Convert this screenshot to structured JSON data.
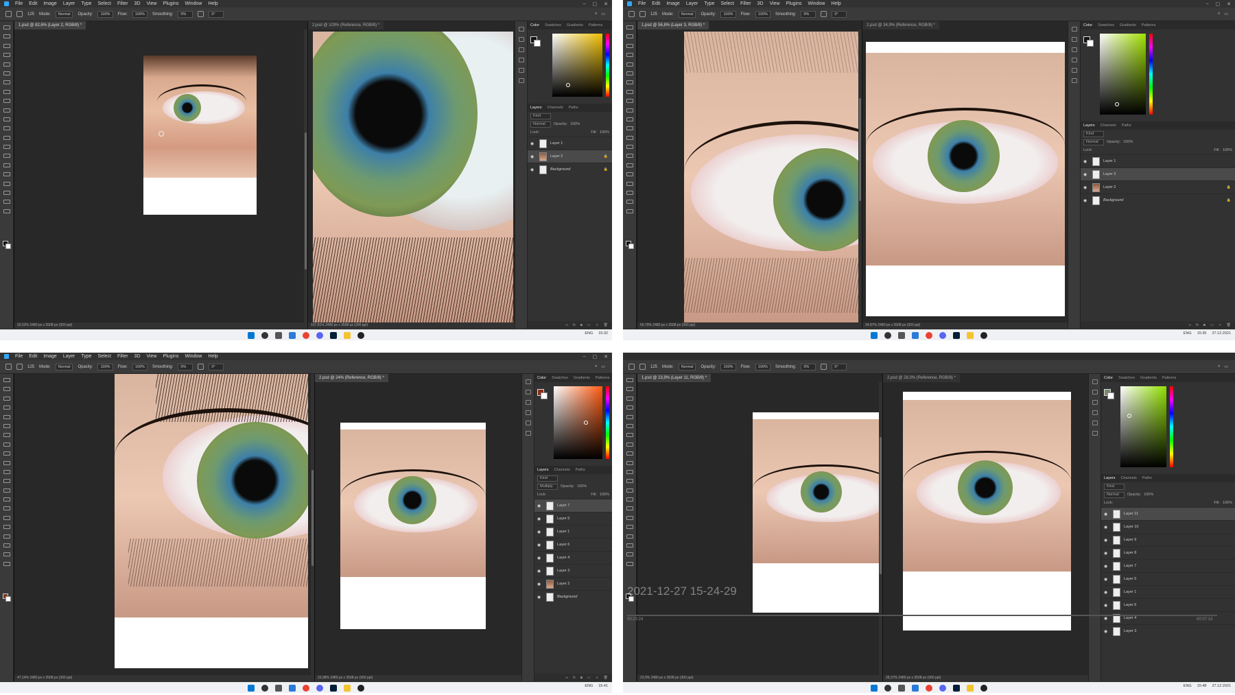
{
  "menu": [
    "File",
    "Edit",
    "Image",
    "Layer",
    "Type",
    "Select",
    "Filter",
    "3D",
    "View",
    "Plugins",
    "Window",
    "Help"
  ],
  "options": {
    "mode_label": "Mode:",
    "mode": "Normal",
    "opacity_label": "Opacity:",
    "opacity": "100%",
    "flow_label": "Flow:",
    "flow": "100%",
    "smoothing_label": "Smoothing:",
    "smoothing": "0%",
    "angle": "0°",
    "brush_size": "125"
  },
  "panel_tabs": [
    "Color",
    "Swatches",
    "Gradients",
    "Patterns"
  ],
  "layer_tabs": [
    "Layers",
    "Channels",
    "Paths"
  ],
  "layer_filter": "Kind",
  "fill_label": "Fill:",
  "lock_label": "Lock:",
  "taskbar": {
    "lang": "ENG"
  },
  "q0": {
    "tab1": "1.psd @ 82,6% (Layer 2, RGB/8) *",
    "tab2": "2.psd @ 103% (Reference, RGB/8) *",
    "status1": "15,53%   2480 px x 3508 px (300 ppi)",
    "status2": "107,81%   2480 px x 3508 px (300 ppi)",
    "blend": "Normal",
    "opacity": "100%",
    "fill": "100%",
    "layers": [
      {
        "name": "Layer 1",
        "italic": false,
        "sel": false,
        "pic": false,
        "lock": false
      },
      {
        "name": "Layer 2",
        "italic": false,
        "sel": true,
        "pic": true,
        "lock": true
      },
      {
        "name": "Background",
        "italic": true,
        "sel": false,
        "pic": false,
        "lock": true
      }
    ],
    "clock": "15:32"
  },
  "q1": {
    "tab1": "1.psd @ 56,8% (Layer 3, RGB/8) *",
    "tab2": "2.psd @ 34,9% (Reference, RGB/8) *",
    "status1": "56,79%   2480 px x 3508 px (300 ppi)",
    "status2": "34,87%   2480 px x 3508 px (300 ppi)",
    "blend": "Normal",
    "opacity": "100%",
    "fill": "100%",
    "layers": [
      {
        "name": "Layer 1",
        "italic": false,
        "sel": false,
        "pic": false,
        "lock": false
      },
      {
        "name": "Layer 3",
        "italic": false,
        "sel": true,
        "pic": false,
        "lock": false
      },
      {
        "name": "Layer 2",
        "italic": false,
        "sel": false,
        "pic": true,
        "lock": true
      },
      {
        "name": "Background",
        "italic": true,
        "sel": false,
        "pic": false,
        "lock": true
      }
    ],
    "clock": "15:35",
    "date": "27.12.2021"
  },
  "q2": {
    "tab1": "1.psd @ 47,1% (Layer 7, RGB/8) *",
    "tab2": "2.psd @ 24% (Reference, RGB/8) *",
    "status1": "47,14%   2480 px x 3508 px (300 ppi)",
    "status2": "23,98%   2480 px x 3508 px (300 ppi)",
    "blend": "Multiply",
    "opacity": "100%",
    "fill": "100%",
    "layers": [
      {
        "name": "Layer 7",
        "italic": false,
        "sel": true,
        "pic": false,
        "lock": false
      },
      {
        "name": "Layer 5",
        "italic": false,
        "sel": false,
        "pic": false,
        "lock": false
      },
      {
        "name": "Layer 1",
        "italic": false,
        "sel": false,
        "pic": false,
        "lock": false
      },
      {
        "name": "Layer 6",
        "italic": false,
        "sel": false,
        "pic": false,
        "lock": false
      },
      {
        "name": "Layer 4",
        "italic": false,
        "sel": false,
        "pic": false,
        "lock": false
      },
      {
        "name": "Layer 3",
        "italic": false,
        "sel": false,
        "pic": false,
        "lock": false
      },
      {
        "name": "Layer 2",
        "italic": false,
        "sel": false,
        "pic": true,
        "lock": false
      },
      {
        "name": "Background",
        "italic": true,
        "sel": false,
        "pic": false,
        "lock": false
      }
    ],
    "clock": "15:41"
  },
  "q3": {
    "tab1": "1.psd @ 23,9% (Layer 11, RGB/8) *",
    "tab2": "2.psd @ 28,3% (Reference, RGB/8) *",
    "status1": "23,9%   2480 px x 3508 px (300 ppi)",
    "status2": "28,37%   2480 px x 3508 px (300 ppi)",
    "blend": "Normal",
    "opacity": "100%",
    "fill": "100%",
    "layers": [
      {
        "name": "Layer 11",
        "italic": false,
        "sel": true,
        "pic": false,
        "lock": false
      },
      {
        "name": "Layer 10",
        "italic": false,
        "sel": false,
        "pic": false,
        "lock": false
      },
      {
        "name": "Layer 9",
        "italic": false,
        "sel": false,
        "pic": false,
        "lock": false
      },
      {
        "name": "Layer 8",
        "italic": false,
        "sel": false,
        "pic": false,
        "lock": false
      },
      {
        "name": "Layer 7",
        "italic": false,
        "sel": false,
        "pic": false,
        "lock": false
      },
      {
        "name": "Layer 5",
        "italic": false,
        "sel": false,
        "pic": false,
        "lock": false
      },
      {
        "name": "Layer 1",
        "italic": false,
        "sel": false,
        "pic": false,
        "lock": false
      },
      {
        "name": "Layer 6",
        "italic": false,
        "sel": false,
        "pic": false,
        "lock": false
      },
      {
        "name": "Layer 4",
        "italic": false,
        "sel": false,
        "pic": false,
        "lock": false
      },
      {
        "name": "Layer 3",
        "italic": false,
        "sel": false,
        "pic": false,
        "lock": false
      }
    ],
    "clock": "15:48",
    "date": "27.12.2021",
    "timestamp": "2021-12-27 15-24-29",
    "recording_time": "00:23:24",
    "recording_total": "00:07:13"
  }
}
